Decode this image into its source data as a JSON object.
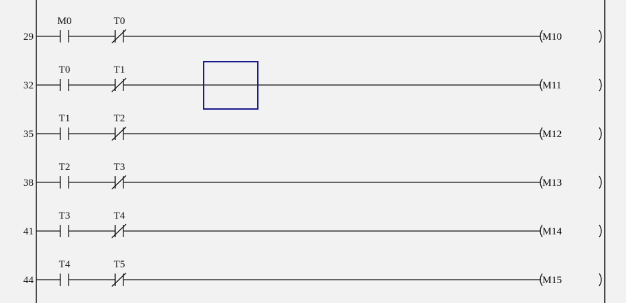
{
  "editor": {
    "rungs": [
      {
        "step": "29",
        "contact_no": "M0",
        "contact_nc": "T0",
        "coil": "M10"
      },
      {
        "step": "32",
        "contact_no": "T0",
        "contact_nc": "T1",
        "coil": "M11"
      },
      {
        "step": "35",
        "contact_no": "T1",
        "contact_nc": "T2",
        "coil": "M12"
      },
      {
        "step": "38",
        "contact_no": "T2",
        "contact_nc": "T3",
        "coil": "M13"
      },
      {
        "step": "41",
        "contact_no": "T3",
        "contact_nc": "T4",
        "coil": "M14"
      },
      {
        "step": "44",
        "contact_no": "T4",
        "contact_nc": "T5",
        "coil": "M15"
      }
    ],
    "cursor_rung": 1,
    "colors": {
      "background": "#f2f2f2",
      "line": "#111111",
      "cursor": "#1a1a8c"
    }
  }
}
